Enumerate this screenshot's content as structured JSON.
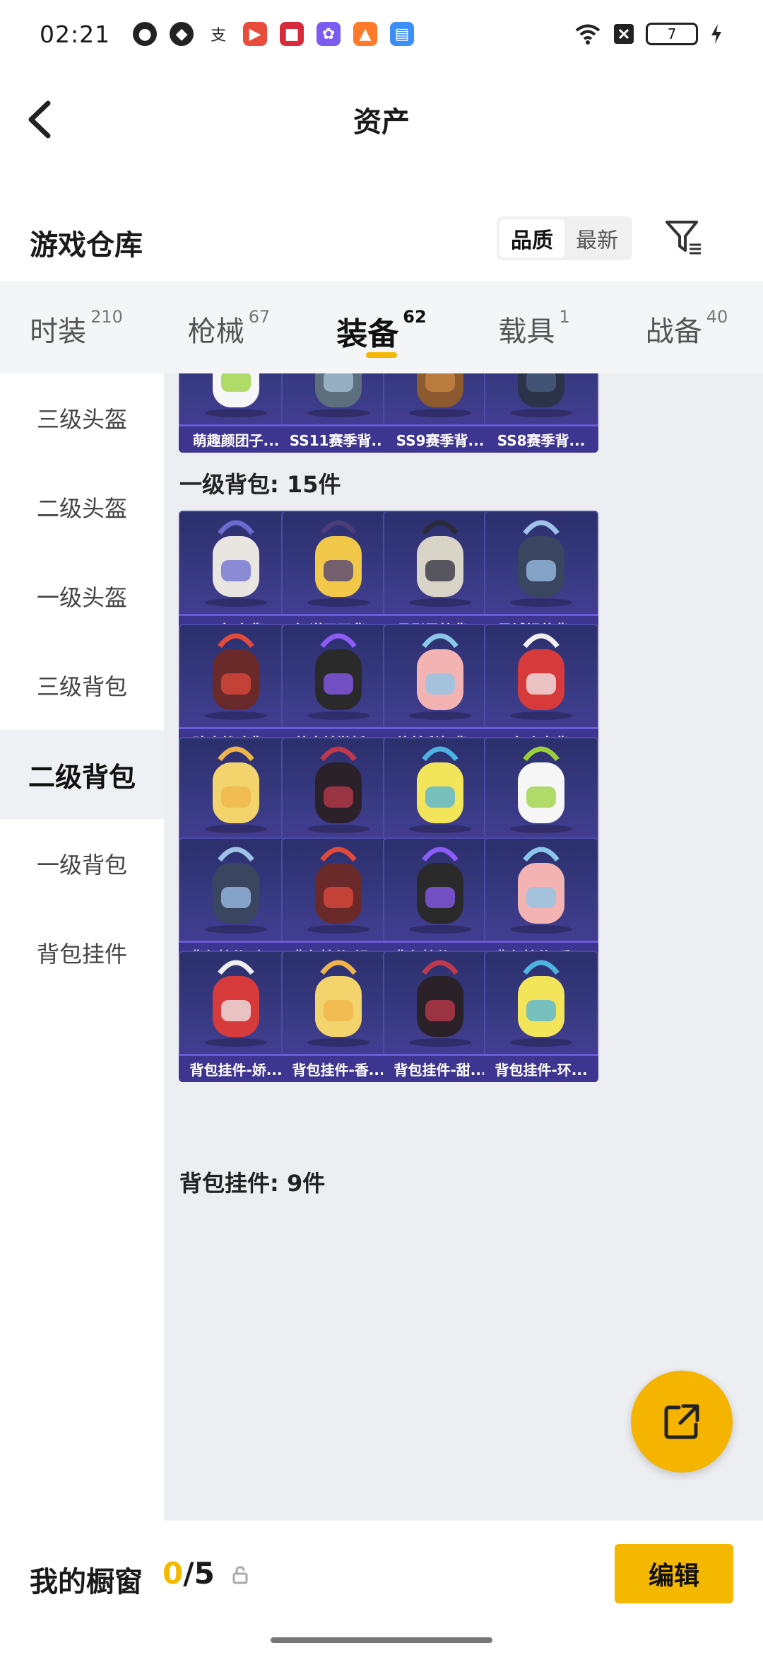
{
  "status": {
    "time": "02:21",
    "battery": "7"
  },
  "header": {
    "title": "资产"
  },
  "section": {
    "title": "游戏仓库",
    "sort_options": [
      "品质",
      "最新"
    ]
  },
  "tabs": [
    {
      "label": "时装",
      "count": "210"
    },
    {
      "label": "枪械",
      "count": "67"
    },
    {
      "label": "装备",
      "count": "62"
    },
    {
      "label": "载具",
      "count": "1"
    },
    {
      "label": "战备",
      "count": "40"
    }
  ],
  "sidebar": [
    "三级头盔",
    "二级头盔",
    "一级头盔",
    "三级背包",
    "二级背包",
    "一级背包",
    "背包挂件"
  ],
  "groups": {
    "bag1": "一级背包: 15件",
    "charm": "背包挂件: 9件"
  },
  "items": {
    "partial": [
      "萌趣颜团子...",
      "SS11赛季背...",
      "SS9赛季背...",
      "SS8赛季背..."
    ],
    "bag1": [
      "巴巴如意背...",
      "智谋强哥背...",
      "月影灵韵背...",
      "异域银装背...",
      "破晓战魂背...",
      "放客神游摇...",
      "旋转彩虹背...",
      "玉兔迎春背...",
      "垂柳戏鸭背...",
      "甜心亚梦背...",
      "香水柠檬背...",
      "萌趣颜团子...",
      "SS11赛季背...",
      "SS9赛季背...",
      "SS8赛季背..."
    ],
    "charm": [
      "背包挂件-未...",
      "背包挂件-银...",
      "背包挂件-玉...",
      "背包挂件-垂...",
      "背包挂件-娇...",
      "背包挂件-香...",
      "背包挂件-甜...",
      "背包挂件-环..."
    ]
  },
  "bottom": {
    "label": "我的橱窗",
    "count_current": "0",
    "count_total": "/5",
    "edit_label": "编辑"
  },
  "colors": {
    "accent": "#f5b800",
    "card_bg": "#35347a"
  }
}
